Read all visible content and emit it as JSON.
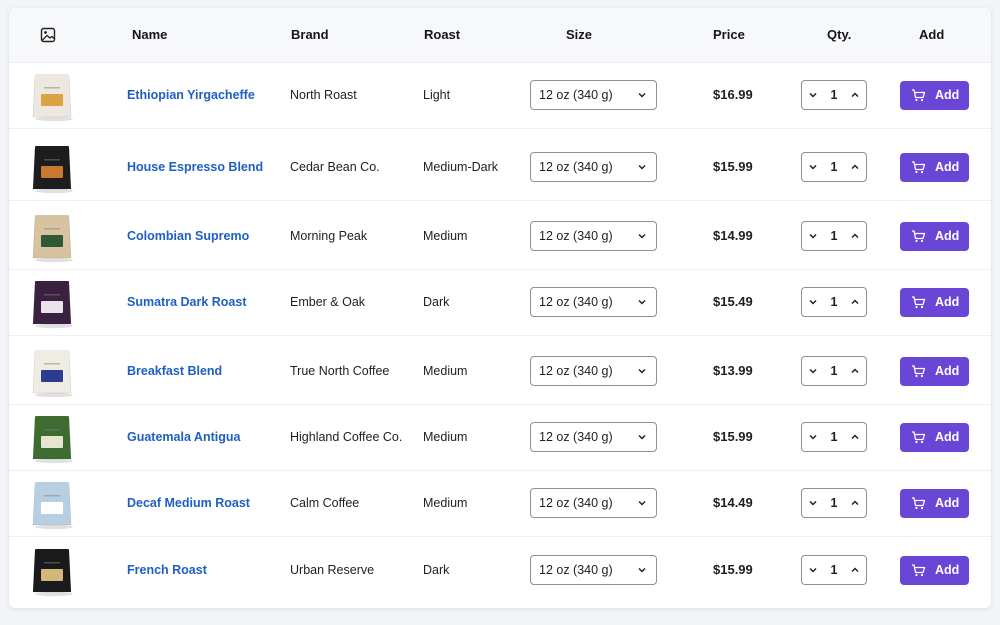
{
  "table": {
    "columns": {
      "image_icon": "image-icon",
      "name": "Name",
      "brand": "Brand",
      "roast": "Roast",
      "size": "Size",
      "price": "Price",
      "qty": "Qty.",
      "add": "Add"
    },
    "rows": [
      {
        "name": "Ethiopian Yirgacheffe",
        "brand": "North Roast",
        "roast": "Light",
        "size": "12 oz (340 g)",
        "price": "$16.99",
        "qty": "1",
        "add": "Add",
        "bag_color": "#ece8df",
        "label_color": "#d9a441"
      },
      {
        "name": "House Espresso Blend",
        "brand": "Cedar Bean Co.",
        "roast": "Medium-Dark",
        "size": "12 oz (340 g)",
        "price": "$15.99",
        "qty": "1",
        "add": "Add",
        "bag_color": "#1d1d20",
        "label_color": "#c8782f"
      },
      {
        "name": "Colombian Supremo",
        "brand": "Morning Peak",
        "roast": "Medium",
        "size": "12 oz (340 g)",
        "price": "$14.99",
        "qty": "1",
        "add": "Add",
        "bag_color": "#d8c3a0",
        "label_color": "#2f5a36"
      },
      {
        "name": "Sumatra Dark Roast",
        "brand": "Ember & Oak",
        "roast": "Dark",
        "size": "12 oz (340 g)",
        "price": "$15.49",
        "qty": "1",
        "add": "Add",
        "bag_color": "#3a2140",
        "label_color": "#e9e2ea"
      },
      {
        "name": "Breakfast Blend",
        "brand": "True North Coffee",
        "roast": "Medium",
        "size": "12 oz (340 g)",
        "price": "$13.99",
        "qty": "1",
        "add": "Add",
        "bag_color": "#efece4",
        "label_color": "#2b3b8f"
      },
      {
        "name": "Guatemala Antigua",
        "brand": "Highland Coffee Co.",
        "roast": "Medium",
        "size": "12 oz (340 g)",
        "price": "$15.99",
        "qty": "1",
        "add": "Add",
        "bag_color": "#3d6b30",
        "label_color": "#e7e4cf"
      },
      {
        "name": "Decaf Medium Roast",
        "brand": "Calm Coffee",
        "roast": "Medium",
        "size": "12 oz (340 g)",
        "price": "$14.49",
        "qty": "1",
        "add": "Add",
        "bag_color": "#b7cfe2",
        "label_color": "#ffffff"
      },
      {
        "name": "French Roast",
        "brand": "Urban Reserve",
        "roast": "Dark",
        "size": "12 oz (340 g)",
        "price": "$15.99",
        "qty": "1",
        "add": "Add",
        "bag_color": "#1a1a1c",
        "label_color": "#d4b87a"
      }
    ]
  },
  "icons": {
    "size_dropdown": "chevron-down-icon",
    "qty_decrease": "chevron-down-icon",
    "qty_increase": "chevron-up-icon",
    "add_button": "cart-icon"
  },
  "colors": {
    "accent": "#6a46d6",
    "link": "#1f5fc4",
    "header_bg": "#f7f8fa"
  }
}
